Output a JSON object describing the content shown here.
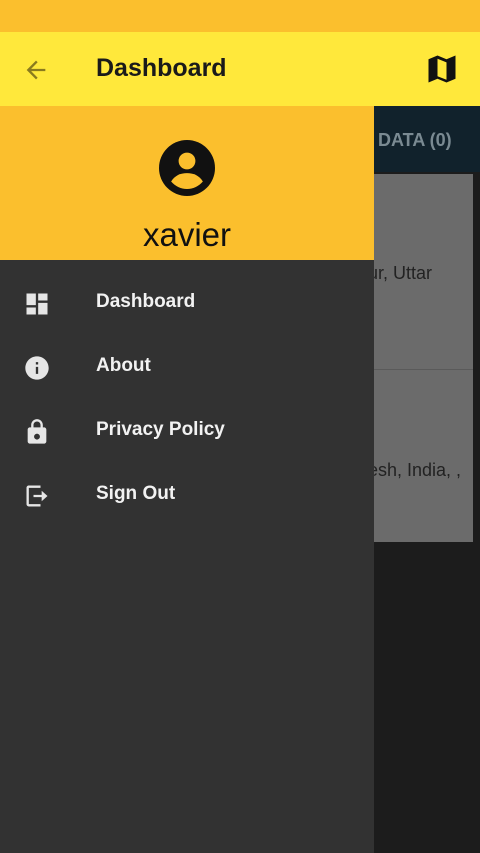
{
  "appbar": {
    "title": "Dashboard",
    "back_icon": "arrow-back-icon",
    "map_icon": "map-icon"
  },
  "background": {
    "tab_label": "DATA (0)",
    "card_text_1": "ur, Uttar",
    "card_text_2": "esh, India, ,"
  },
  "drawer": {
    "username": "xavier",
    "items": [
      {
        "label": "Dashboard",
        "icon": "dashboard-icon"
      },
      {
        "label": "About",
        "icon": "info-icon"
      },
      {
        "label": "Privacy Policy",
        "icon": "lock-icon"
      },
      {
        "label": "Sign Out",
        "icon": "sign-out-icon"
      }
    ]
  },
  "colors": {
    "accent": "#fbbf2d",
    "appbar": "#ffe83b",
    "drawer": "#323232"
  }
}
